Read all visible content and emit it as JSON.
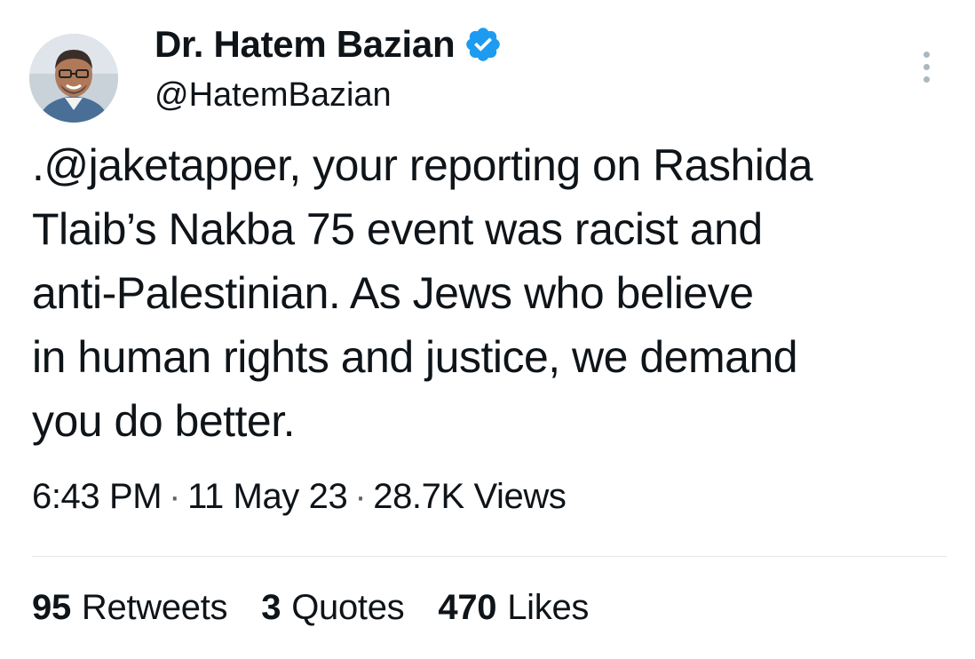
{
  "author": {
    "display_name": "Dr. Hatem Bazian",
    "handle": "@HatemBazian",
    "verified": true,
    "verified_color": "#1d9bf0"
  },
  "tweet": {
    "text": ".@jaketapper, your reporting on Rashida\nTlaib’s Nakba 75 event was racist and\nanti-Palestinian. As Jews who believe\nin human rights and justice, we demand\nyou do better.",
    "time": "6:43 PM",
    "date": "11 May 23",
    "views_count": "28.7K",
    "views_label": "Views",
    "separator": "·"
  },
  "stats": {
    "retweets_count": "95",
    "retweets_label": "Retweets",
    "quotes_count": "3",
    "quotes_label": "Quotes",
    "likes_count": "470",
    "likes_label": "Likes"
  },
  "icons": {
    "verified": "verified-badge-icon",
    "more": "more-options-icon"
  }
}
